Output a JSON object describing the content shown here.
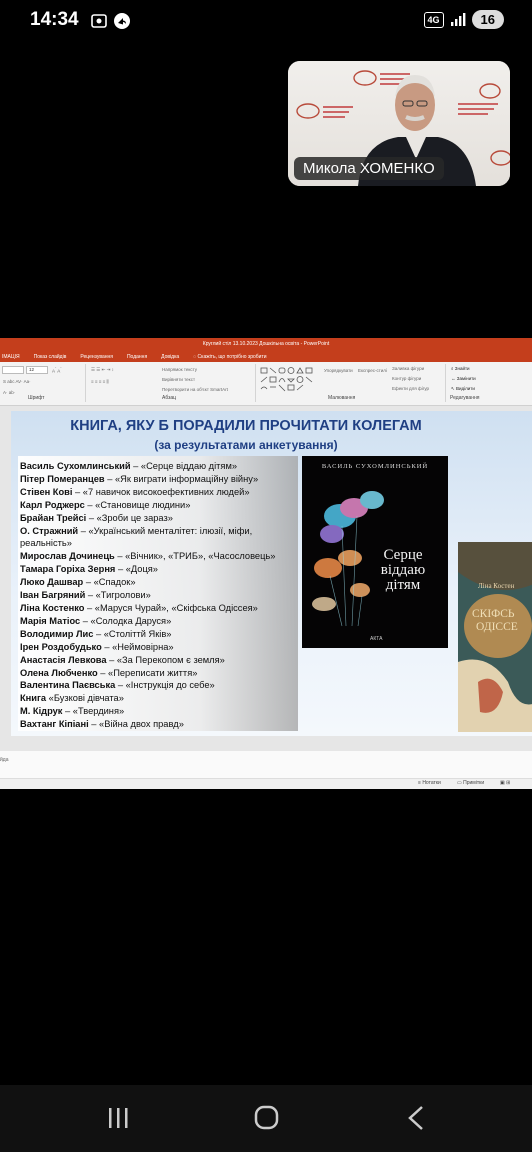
{
  "status": {
    "time": "14:34",
    "network": "4G",
    "battery": "16"
  },
  "video": {
    "speaker": "Микола ХОМЕНКО"
  },
  "app": {
    "window_title": "Круглий стіл 13.10.2023 Дошкільна освіта  -  PowerPoint",
    "menu": [
      "ІМАЦІЯ",
      "Показ слайдів",
      "Рецензування",
      "Подання",
      "Довідка",
      "Скажіть, що потрібно зробити"
    ],
    "ribbon_groups": [
      "Шрифт",
      "Абзац",
      "Малювання",
      "Редагування"
    ],
    "ribbon_commands": {
      "text_direction": "Напрямок тексту",
      "align_text": "Вирівняти текст",
      "smartart": "Перетворити на об'єкт SmartArt",
      "arrange": "Упорядкувати",
      "quick_styles": "Експрес-стилі",
      "shape_fill": "Заливка фігури",
      "shape_outline": "Контур фігури",
      "shape_effects": "Ефекти для фігур",
      "find": "Знайти",
      "replace": "Замінити",
      "select": "Виділити",
      "font_size": "12"
    },
    "notes_hint": "йда",
    "statusbar": {
      "notes": "Нотатки",
      "comments": "Примітки"
    }
  },
  "slide": {
    "title": "КНИГА, ЯКУ Б ПОРАДИЛИ ПРОЧИТАТИ КОЛЕГАМ",
    "subtitle": "(за результатами анкетування)",
    "items": [
      {
        "author": "Василь Сухомлинський",
        "book": " – «Серце віддаю дітям»"
      },
      {
        "author": "Пітер Померанцев",
        "book": " – «Як виграти інформаційну війну»"
      },
      {
        "author": "Стівен Кові",
        "book": " – «7 навичок високоефективних людей»"
      },
      {
        "author": "Карл Роджерс",
        "book": " – «Становище людини»"
      },
      {
        "author": "Брайан Трейсі",
        "book": " – «Зроби це зараз»"
      },
      {
        "author": "О. Стражний",
        "book": " – «Український менталітет: ілюзії, міфи, реальність»"
      },
      {
        "author": "Мирослав Дочинець",
        "book": " – «Вічник», «ТРИБ», «Часословець»"
      },
      {
        "author": "Тамара Горіха Зерня",
        "book": " – «Доця»"
      },
      {
        "author": "Люко Дашвар",
        "book": " – «Спадок»"
      },
      {
        "author": "Іван Багряний",
        "book": " – «Тигролови»"
      },
      {
        "author": "Ліна Костенко",
        "book": " – «Маруся Чурай», «Скіфська Одіссея»"
      },
      {
        "author": "Марія Матіос",
        "book": " – «Солодка Даруся»"
      },
      {
        "author": "Володимир Лис",
        "book": " – «Століттй Яків»"
      },
      {
        "author": "Ірен Роздобудько",
        "book": " – «Неймовірна»"
      },
      {
        "author": "Анастасія Левкова",
        "book": " – «За Перекопом є земля»"
      },
      {
        "author": "Олена Любченко",
        "book": " – «Переписати життя»"
      },
      {
        "author": "Валентина Паєвська",
        "book": " – «Інструкція до себе»"
      },
      {
        "author": "Книга",
        "book": " «Бузкові дівчата»"
      },
      {
        "author": "М. Кідрук",
        "book": " – «Твердиня»"
      },
      {
        "author": "Вахтанг Кіпіані",
        "book": " – «Війна двох правд»"
      }
    ],
    "book1": {
      "author": "ВАСИЛЬ СУХОМЛИНСЬКИЙ",
      "title_l1": "Серце",
      "title_l2": "віддаю",
      "title_l3": "дітям",
      "publisher": "АКТА"
    },
    "book2": {
      "author": "Ліна Костен",
      "title_l1": "СКІФСЬ",
      "title_l2": "ОДІССЕ"
    }
  }
}
